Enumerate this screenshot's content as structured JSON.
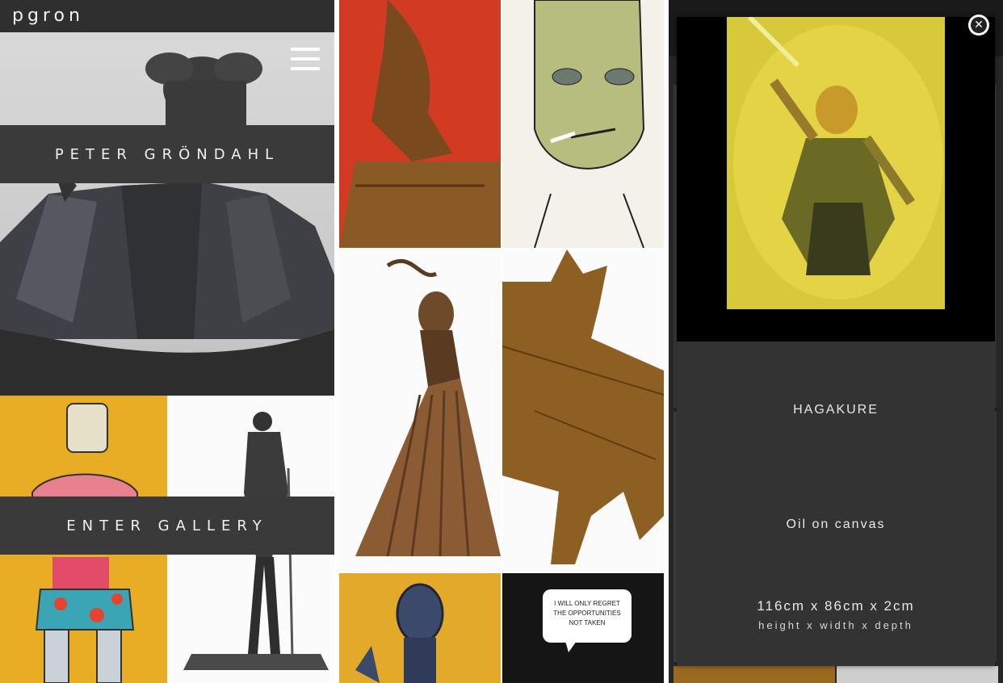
{
  "header": {
    "logo": "pgron"
  },
  "hero": {
    "artist_name": "PETER GRÖNDAHL"
  },
  "menu": {
    "icon": "hamburger-menu-icon"
  },
  "gallery_entry": {
    "label": "ENTER GALLERY"
  },
  "modal": {
    "title": "HAGAKURE",
    "medium": "Oil on canvas",
    "dimensions": "116cm x 86cm x 2cm",
    "dimensions_label": "height x width x depth",
    "close_icon": "close-icon"
  },
  "speech_bubble": {
    "text": "I WILL ONLY REGRET THE OPPORTUNITIES NOT TAKEN"
  },
  "colors": {
    "band": "#3a3a3a",
    "modal": "#333333",
    "accent_yellow": "#e9b429"
  }
}
